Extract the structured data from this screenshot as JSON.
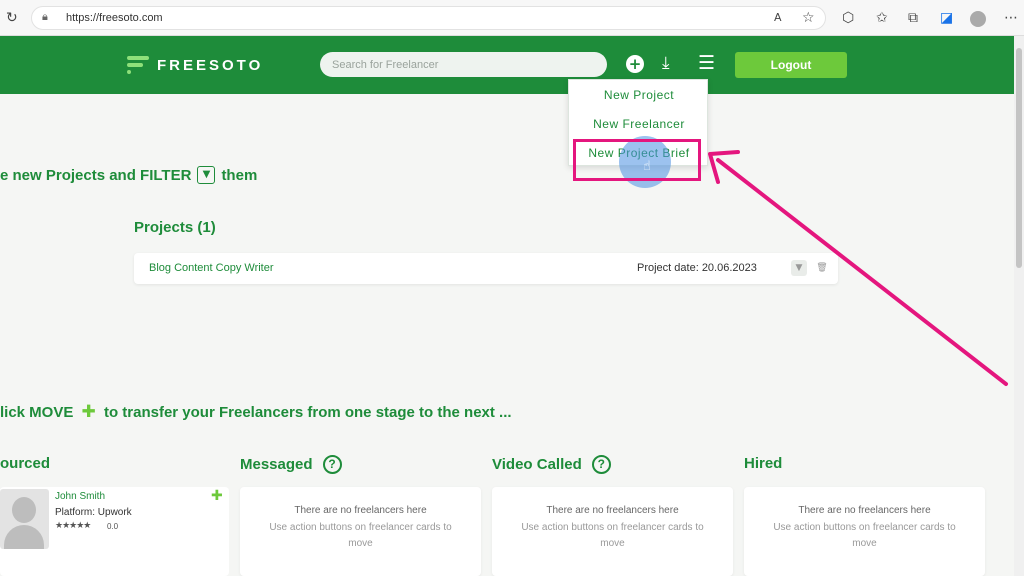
{
  "browser": {
    "url": "https://freesoto.com",
    "reload_icon": "reload-icon",
    "lock_icon": "lock-icon"
  },
  "header": {
    "logo_text": "FREESOTO",
    "search_placeholder": "Search for Freelancer",
    "logout_label": "Logout",
    "brand_color": "#1e8c3a",
    "accent_color": "#6dc93b"
  },
  "dropdown": {
    "items": [
      {
        "label": "New Project"
      },
      {
        "label": "New Freelancer"
      },
      {
        "label": "New Project Brief"
      }
    ],
    "highlight_color": "#e4167e"
  },
  "hint_filter": {
    "prefix": "e new Projects and FILTER",
    "suffix": "them"
  },
  "projects": {
    "title": "Projects (1)",
    "rows": [
      {
        "name": "Blog Content Copy Writer",
        "date": "Project date: 20.06.2023"
      }
    ]
  },
  "hint_move": {
    "prefix": "lick MOVE",
    "suffix": "to transfer your Freelancers from one stage to the next ..."
  },
  "stages": [
    {
      "title": "ourced"
    },
    {
      "title": "Messaged",
      "empty_title": "There are no freelancers here",
      "empty_sub": "Use action buttons on freelancer cards to move"
    },
    {
      "title": "Video Called",
      "empty_title": "There are no freelancers here",
      "empty_sub": "Use action buttons on freelancer cards to move"
    },
    {
      "title": "Hired",
      "empty_title": "There are no freelancers here",
      "empty_sub": "Use action buttons on freelancer cards to move"
    }
  ],
  "freelancer": {
    "name": "John Smith",
    "platform": "Platform: Upwork",
    "stars": "★★★★★",
    "rating": "0.0"
  }
}
